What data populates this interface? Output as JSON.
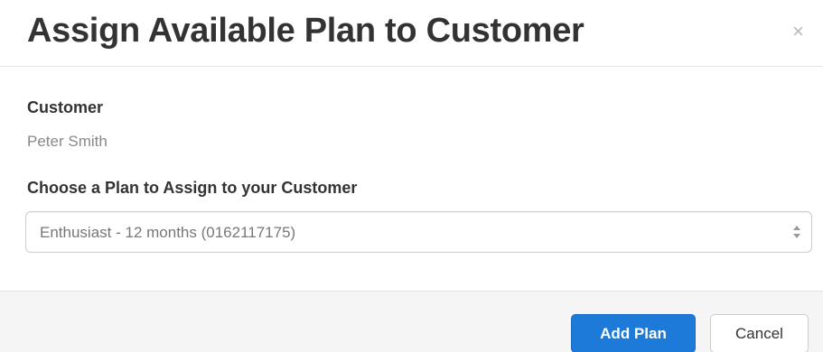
{
  "dialog": {
    "title": "Assign Available Plan to Customer",
    "close_icon": "close-icon",
    "close_glyph": "×"
  },
  "customer": {
    "label": "Customer",
    "value": "Peter Smith"
  },
  "plan": {
    "label": "Choose a Plan to Assign to your Customer",
    "selected": "Enthusiast - 12 months (0162117175)",
    "icon": "select-arrows-icon"
  },
  "footer": {
    "add_label": "Add Plan",
    "cancel_label": "Cancel"
  },
  "colors": {
    "primary": "#1e7ad8",
    "footer_bg": "#f5f5f5",
    "title_text": "#333333",
    "muted_text": "#888888"
  }
}
